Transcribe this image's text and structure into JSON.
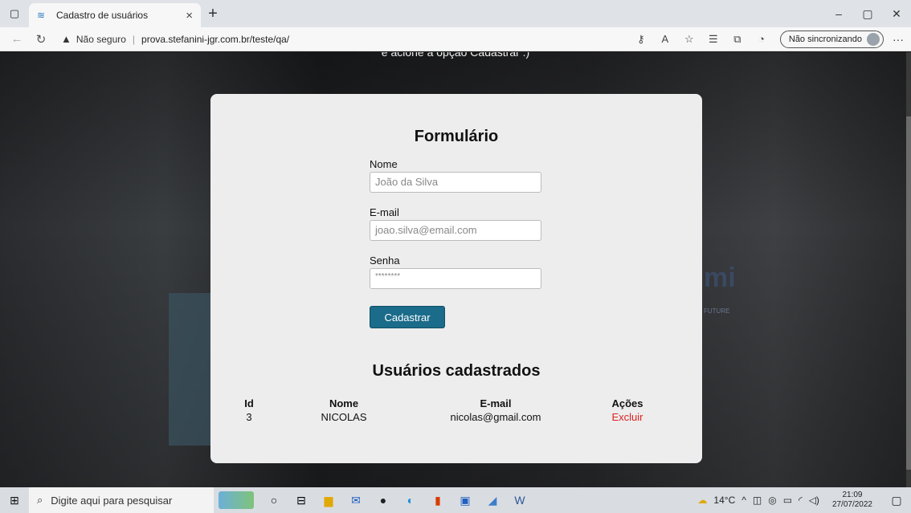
{
  "browser": {
    "tab_title": "Cadastro de usuários",
    "tab_close": "×",
    "new_tab": "+",
    "window_controls": {
      "minimize": "–",
      "restore": "▢",
      "close": "✕"
    },
    "address": {
      "security_label": "Não seguro",
      "url": "prova.stefanini-jgr.com.br/teste/qa/"
    },
    "sync_label": "Não sincronizando",
    "more": "···"
  },
  "page": {
    "top_cut_text": "e acione a opção Cadastrar :)",
    "form": {
      "title": "Formulário",
      "fields": [
        {
          "label": "Nome",
          "placeholder": "João da Silva"
        },
        {
          "label": "E-mail",
          "placeholder": "joao.silva@email.com"
        },
        {
          "label": "Senha",
          "placeholder": "********"
        }
      ],
      "submit_label": "Cadastrar"
    },
    "users": {
      "title": "Usuários cadastrados",
      "columns": [
        "Id",
        "Nome",
        "E-mail",
        "Ações"
      ],
      "rows": [
        {
          "id": "3",
          "name": "NICOLAS",
          "email": "nicolas@gmail.com",
          "action": "Excluir"
        }
      ]
    },
    "background_brand": {
      "mark": "mi",
      "sub": "FUTURE"
    }
  },
  "taskbar": {
    "search_placeholder": "Digite aqui para pesquisar",
    "temperature": "14°C",
    "time": "21:09",
    "date": "27/07/2022"
  },
  "colors": {
    "button_bg": "#1b6b8a",
    "delete_link": "#e02020",
    "card_bg": "#ededed"
  }
}
